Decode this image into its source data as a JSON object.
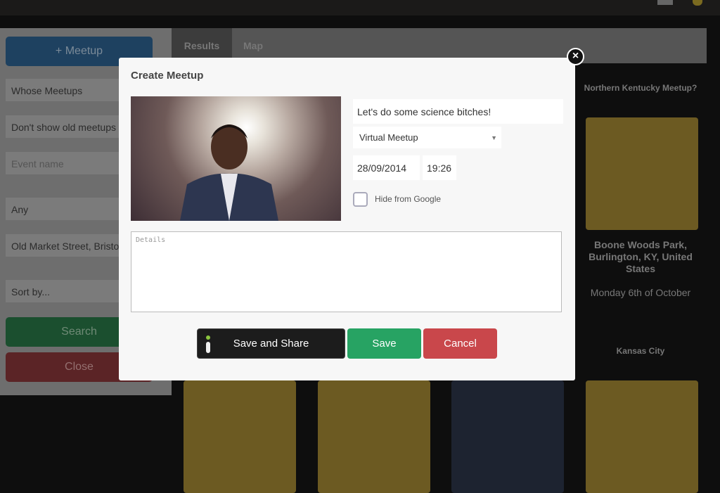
{
  "topbar": {
    "icons": [
      "mail-icon",
      "bell-icon"
    ]
  },
  "sidebar": {
    "add_button": "+ Meetup",
    "whose": "Whose Meetups",
    "old": "Don't show old meetups",
    "event_placeholder": "Event name",
    "any": "Any",
    "location": "Old Market Street, Bristol",
    "sort": "Sort by...",
    "search": "Search",
    "close": "Close"
  },
  "tabs": [
    {
      "label": "Results"
    },
    {
      "label": "Map"
    }
  ],
  "results": [
    {
      "title": "Northern Kentucky Meetup?",
      "location": "Boone Woods Park, Burlington, KY, United States",
      "date": "Monday 6th of October"
    },
    {
      "title": "Kansas City"
    }
  ],
  "modal": {
    "title": "Create Meetup",
    "name_value": "Let's do some science bitches!",
    "type_value": "Virtual Meetup",
    "date_value": "28/09/2014",
    "time_value": "19:26",
    "hide_label": "Hide from Google",
    "hide_checked": false,
    "details_placeholder": "Details",
    "save_share": "Save and Share",
    "save": "Save",
    "cancel": "Cancel",
    "colors": {
      "save": "#27a363",
      "cancel": "#c9474b",
      "share": "#1c1c1c"
    }
  }
}
